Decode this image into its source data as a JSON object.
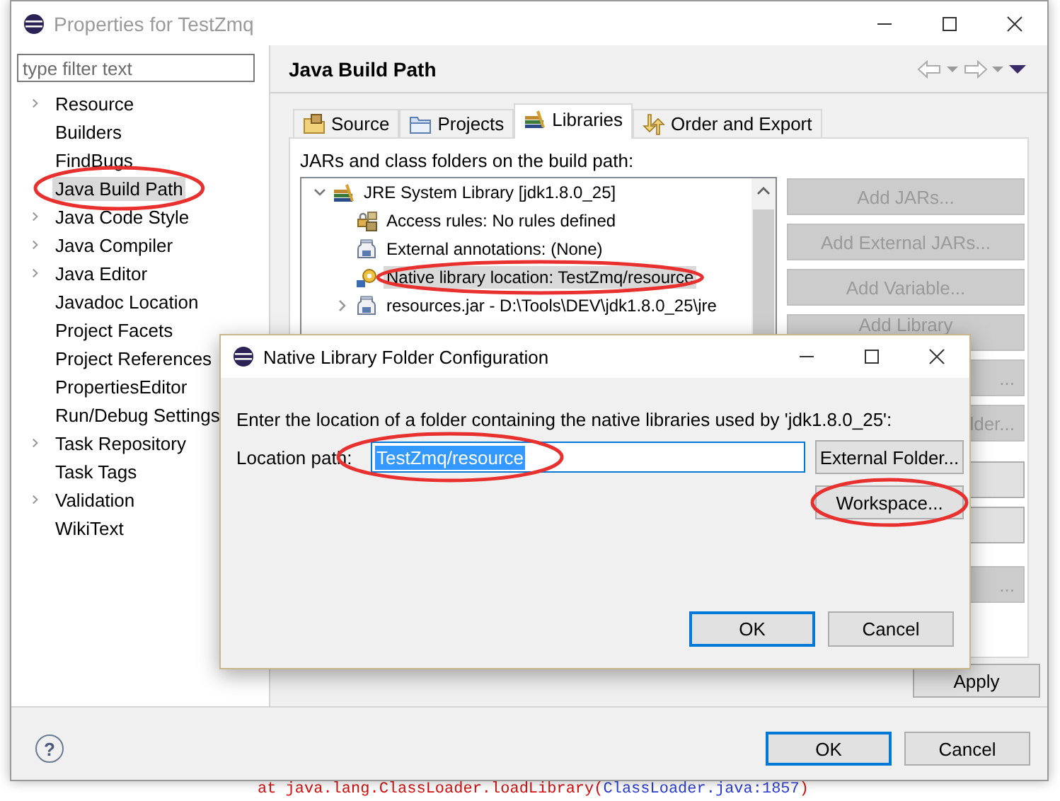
{
  "window": {
    "title": "Properties for TestZmq",
    "active": false
  },
  "nav": {
    "filter": {
      "placeholder": "type filter text"
    },
    "items": [
      {
        "label": "Resource",
        "expanded": false,
        "selected": false,
        "circled": false
      },
      {
        "label": "Builders",
        "selected": false,
        "circled": false
      },
      {
        "label": "FindBugs",
        "selected": false,
        "circled": false
      },
      {
        "label": "Java Build Path",
        "selected": true,
        "circled": true
      },
      {
        "label": "Java Code Style",
        "expanded": false,
        "selected": false,
        "circled": false
      },
      {
        "label": "Java Compiler",
        "expanded": false,
        "selected": false,
        "circled": false
      },
      {
        "label": "Java Editor",
        "expanded": false,
        "selected": false,
        "circled": false
      },
      {
        "label": "Javadoc Location",
        "selected": false,
        "circled": false
      },
      {
        "label": "Project Facets",
        "selected": false,
        "circled": false
      },
      {
        "label": "Project References",
        "selected": false,
        "circled": false
      },
      {
        "label": "PropertiesEditor",
        "selected": false,
        "circled": false
      },
      {
        "label": "Run/Debug Settings",
        "selected": false,
        "circled": false
      },
      {
        "label": "Task Repository",
        "expanded": false,
        "selected": false,
        "circled": false
      },
      {
        "label": "Task Tags",
        "selected": false,
        "circled": false
      },
      {
        "label": "Validation",
        "expanded": false,
        "selected": false,
        "circled": false
      },
      {
        "label": "WikiText",
        "selected": false,
        "circled": false
      }
    ]
  },
  "page": {
    "title": "Java Build Path",
    "tabs": [
      {
        "label": "Source",
        "kind": "source",
        "selected": false
      },
      {
        "label": "Projects",
        "kind": "folder",
        "selected": false
      },
      {
        "label": "Libraries",
        "kind": "books",
        "selected": true
      },
      {
        "label": "Order and Export",
        "kind": "arrows",
        "selected": false
      }
    ],
    "caption": "JARs and class folders on the build path:",
    "tree": [
      {
        "label": "JRE System Library [jdk1.8.0_25]",
        "kind": "books",
        "expanded": true,
        "selected": false,
        "circled": false,
        "children": [
          {
            "label": "Access rules: No rules defined",
            "kind": "padlock",
            "selected": false,
            "circled": false
          },
          {
            "label": "External annotations: (None)",
            "kind": "jar",
            "selected": false,
            "circled": false
          },
          {
            "label": "Native library location: TestZmq/resource",
            "kind": "gear",
            "selected": true,
            "circled": true
          },
          {
            "label": "resources.jar - D:\\Tools\\DEV\\jdk1.8.0_25\\jre",
            "kind": "jar",
            "expanded": false,
            "selected": false,
            "circled": false
          }
        ]
      }
    ],
    "buttons": [
      {
        "label": "Add JARs...",
        "disabled": true
      },
      {
        "label": "Add External JARs...",
        "disabled": true
      },
      {
        "label": "Add Variable...",
        "disabled": true
      },
      {
        "label": "Add Library",
        "disabled": true
      },
      {
        "label": "...",
        "disabled": true
      },
      {
        "label": "lder...",
        "disabled": true
      },
      {
        "disabled": false
      },
      {
        "disabled": false
      },
      {
        "label": "...",
        "disabled": true
      }
    ],
    "apply": "Apply"
  },
  "footer": {
    "help": "?",
    "actions": [
      {
        "label": "OK",
        "default": true
      },
      {
        "label": "Cancel",
        "default": false
      }
    ]
  },
  "dialog": {
    "title": "Native Library Folder Configuration",
    "active": true,
    "prompt": "Enter the location of a folder containing the native libraries used by 'jdk1.8.0_25':",
    "field": {
      "label": "Location path:",
      "value": "TestZmq/resource",
      "selected_text": true,
      "circled": true
    },
    "buttons": [
      {
        "label": "External Folder...",
        "circled": false
      },
      {
        "label": "Workspace...",
        "circled": true
      }
    ],
    "actions": [
      {
        "label": "OK",
        "default": true
      },
      {
        "label": "Cancel",
        "default": false
      }
    ]
  },
  "console": {
    "prefix": "at java.lang.ClassLoader.loadLibrary(",
    "link": "ClassLoader.java:1857",
    "suffix": ")"
  }
}
